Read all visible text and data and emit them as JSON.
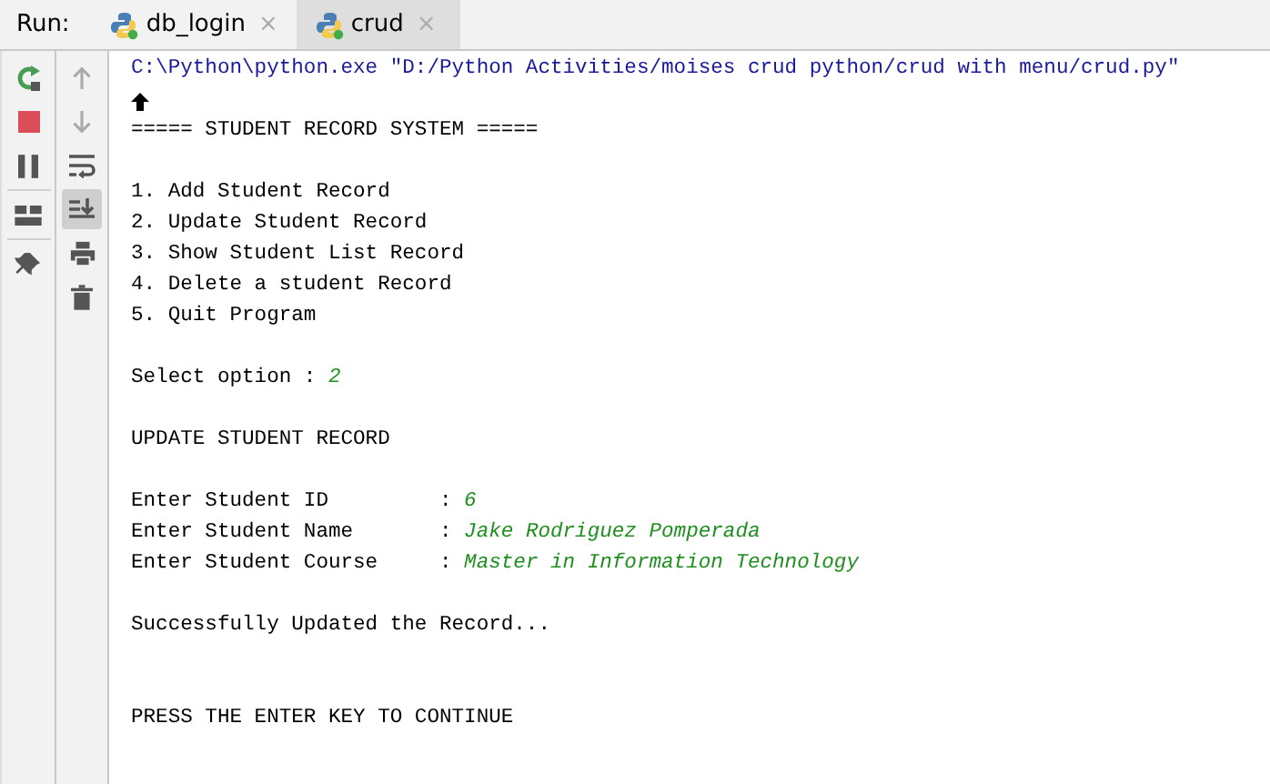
{
  "run_label": "Run:",
  "tabs": [
    {
      "label": "db_login",
      "selected": false,
      "close": "×"
    },
    {
      "label": "crud",
      "selected": true,
      "close": "×"
    }
  ],
  "tools_left": [
    {
      "kind": "rerun"
    },
    {
      "kind": "stop"
    },
    {
      "kind": "pause"
    },
    {
      "kind": "sep"
    },
    {
      "kind": "layout"
    },
    {
      "kind": "sep"
    },
    {
      "kind": "pin"
    }
  ],
  "tools_right": [
    {
      "kind": "up",
      "selected": false
    },
    {
      "kind": "down",
      "selected": false
    },
    {
      "kind": "wrap",
      "selected": false
    },
    {
      "kind": "scroll-end",
      "selected": true
    },
    {
      "kind": "print",
      "selected": false
    },
    {
      "kind": "trash",
      "selected": false
    }
  ],
  "console": [
    {
      "kind": "command",
      "text": "C:\\Python\\python.exe \"D:/Python Activities/moises crud python/crud with menu/crud.py\""
    },
    {
      "kind": "marker"
    },
    {
      "kind": "out",
      "text": "===== STUDENT RECORD SYSTEM ====="
    },
    {
      "kind": "blank"
    },
    {
      "kind": "out",
      "text": "1. Add Student Record"
    },
    {
      "kind": "out",
      "text": "2. Update Student Record"
    },
    {
      "kind": "out",
      "text": "3. Show Student List Record"
    },
    {
      "kind": "out",
      "text": "4. Delete a student Record"
    },
    {
      "kind": "out",
      "text": "5. Quit Program"
    },
    {
      "kind": "blank"
    },
    {
      "kind": "out",
      "text": "Select option : ",
      "input": "2"
    },
    {
      "kind": "blank"
    },
    {
      "kind": "out",
      "text": "UPDATE STUDENT RECORD"
    },
    {
      "kind": "blank"
    },
    {
      "kind": "out",
      "text": "Enter Student ID         : ",
      "input": "6"
    },
    {
      "kind": "out",
      "text": "Enter Student Name       : ",
      "input": "Jake Rodriguez Pomperada"
    },
    {
      "kind": "out",
      "text": "Enter Student Course     : ",
      "input": "Master in Information Technology"
    },
    {
      "kind": "blank"
    },
    {
      "kind": "out",
      "text": "Successfully Updated the Record..."
    },
    {
      "kind": "blank"
    },
    {
      "kind": "blank"
    },
    {
      "kind": "out",
      "text": "PRESS THE ENTER KEY TO CONTINUE"
    }
  ]
}
